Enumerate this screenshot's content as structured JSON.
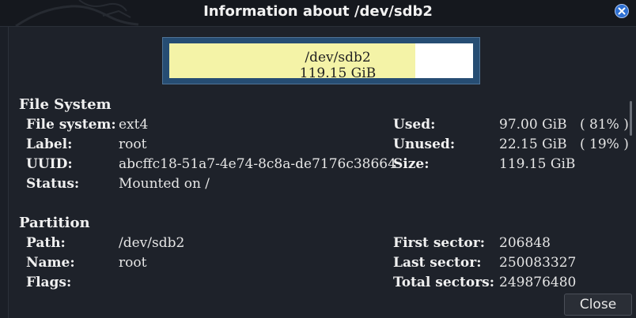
{
  "window": {
    "title": "Information about /dev/sdb2"
  },
  "usage_bar": {
    "device": "/dev/sdb2",
    "size": "119.15 GiB",
    "used_fraction": 0.81
  },
  "filesystem": {
    "heading": "File System",
    "rows": [
      {
        "label": "File system:",
        "value": "ext4"
      },
      {
        "label": "Label:",
        "value": "root"
      },
      {
        "label": "UUID:",
        "value": "abcffc18-51a7-4e74-8c8a-de7176c38664"
      },
      {
        "label": "Status:",
        "value": "Mounted on /"
      }
    ],
    "usage": [
      {
        "label": "Used:",
        "value": "97.00 GiB",
        "percent": "( 81% )"
      },
      {
        "label": "Unused:",
        "value": "22.15 GiB",
        "percent": "( 19% )"
      },
      {
        "label": "Size:",
        "value": "119.15 GiB",
        "percent": ""
      }
    ]
  },
  "partition": {
    "heading": "Partition",
    "rows": [
      {
        "label": "Path:",
        "value": "/dev/sdb2"
      },
      {
        "label": "Name:",
        "value": "root"
      },
      {
        "label": "Flags:",
        "value": ""
      }
    ],
    "sectors": [
      {
        "label": "First sector:",
        "value": "206848"
      },
      {
        "label": "Last sector:",
        "value": "250083327"
      },
      {
        "label": "Total sectors:",
        "value": "249876480"
      }
    ]
  },
  "buttons": {
    "close": "Close"
  },
  "colors": {
    "used": "#f4f3a7",
    "unused": "#ffffff",
    "frame": "#264d73",
    "close_icon": "#2d6fd2"
  },
  "icons": {
    "window_close": "close-icon"
  }
}
